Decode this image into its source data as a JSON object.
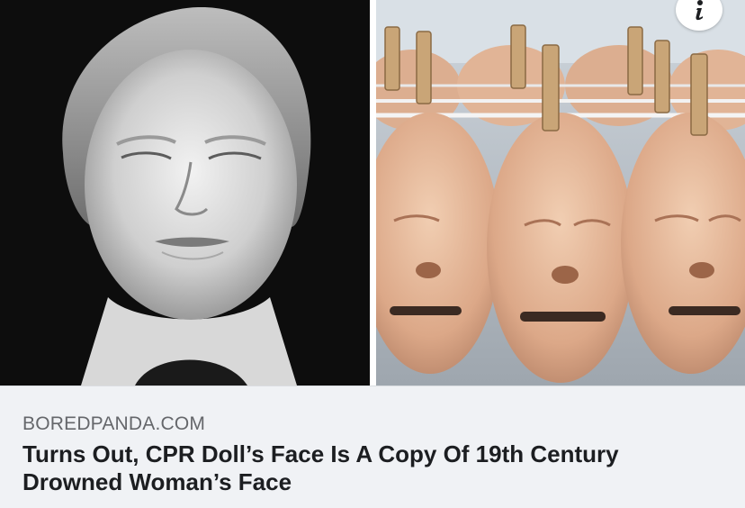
{
  "link_preview": {
    "domain": "BOREDPANDA.COM",
    "headline_lines": [
      "Turns Out, CPR Doll’s Face Is A Copy Of 19th Century",
      "Drowned Woman’s Face"
    ]
  },
  "icons": {
    "info": "info-icon"
  },
  "colors": {
    "caption_bg": "#f0f2f5",
    "domain_text": "#65676b",
    "headline_text": "#1c1e21"
  }
}
